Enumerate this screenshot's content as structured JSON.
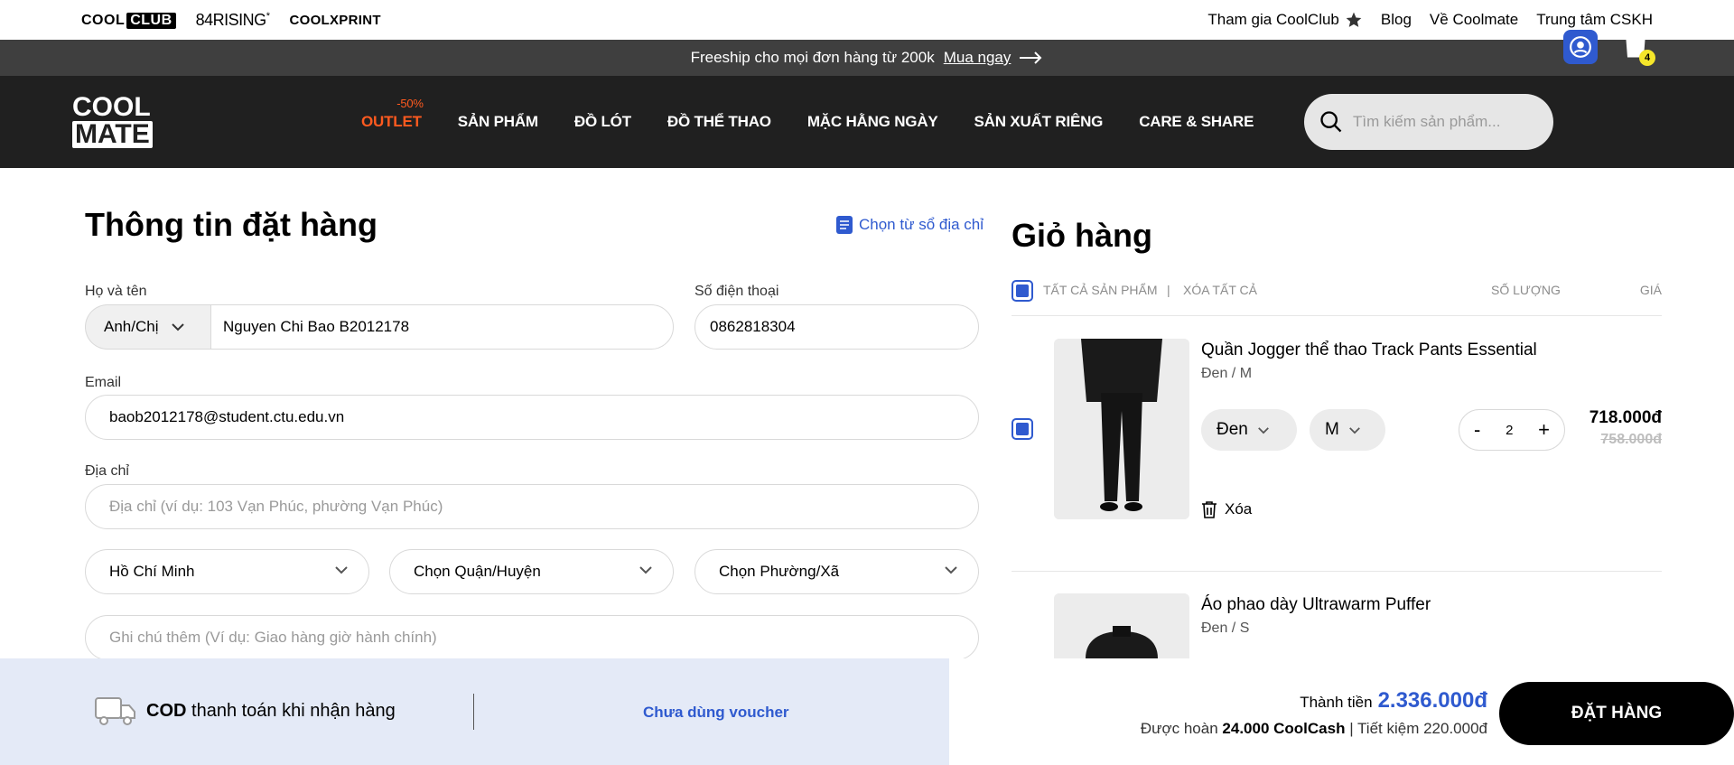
{
  "topbar": {
    "brands": {
      "coolclub_a": "COOL",
      "coolclub_b": "CLUB",
      "rising": "84RISING",
      "rising_sup": "*",
      "coolxprint": "COOLXPRINT"
    },
    "links": [
      "Tham gia CoolClub",
      "Blog",
      "Về Coolmate",
      "Trung tâm CSKH"
    ]
  },
  "promo": {
    "text": "Freeship cho mọi đơn hàng từ 200k",
    "cta": "Mua ngay"
  },
  "header": {
    "logo_top": "COOL",
    "logo_bottom": "MATE",
    "nav": {
      "outlet": "OUTLET",
      "outlet_badge": "-50%",
      "items": [
        "SẢN PHẨM",
        "ĐỒ LÓT",
        "ĐỒ THỂ THAO",
        "MẶC HẰNG NGÀY",
        "SẢN XUẤT RIÊNG",
        "CARE & SHARE"
      ]
    },
    "search_placeholder": "Tìm kiếm sản phẩm...",
    "cart_count": "4"
  },
  "form": {
    "title": "Thông tin đặt hàng",
    "address_book": "Chọn từ sổ địa chỉ",
    "name_label": "Họ và tên",
    "salutation": "Anh/Chị",
    "name_value": "Nguyen Chi Bao B2012178",
    "phone_label": "Số điện thoại",
    "phone_value": "0862818304",
    "email_label": "Email",
    "email_value": "baob2012178@student.ctu.edu.vn",
    "address_label": "Địa chỉ",
    "address_placeholder": "Địa chỉ (ví dụ: 103 Vạn Phúc, phường Vạn Phúc)",
    "city": "Hồ Chí Minh",
    "district": "Chọn Quận/Huyện",
    "ward": "Chọn Phường/Xã",
    "note_placeholder": "Ghi chú thêm (Ví dụ: Giao hàng giờ hành chính)"
  },
  "cart": {
    "title": "Giỏ hàng",
    "select_all": "TẤT CẢ SẢN PHẨM",
    "separator": "|",
    "delete_all": "XÓA TẤT CẢ",
    "qty_header": "SỐ LƯỢNG",
    "price_header": "GIÁ",
    "items": [
      {
        "name": "Quần Jogger thể thao Track Pants Essential",
        "variant": "Đen / M",
        "color": "Đen",
        "size": "M",
        "qty": "2",
        "minus": "-",
        "plus": "+",
        "price": "718.000đ",
        "old_price": "758.000đ",
        "remove": "Xóa"
      },
      {
        "name": "Áo phao dày Ultrawarm Puffer",
        "variant": "Đen / S"
      }
    ]
  },
  "footer": {
    "payment_bold": "COD",
    "payment_rest": "thanh toán khi nhận hàng",
    "voucher": "Chưa dùng voucher",
    "total_label": "Thành tiền",
    "total_value": "2.336.000đ",
    "cashback_prefix": "Được hoàn",
    "cashback_value": "24.000 CoolCash",
    "savings": "| Tiết kiệm 220.000đ",
    "order_button": "ĐẶT HÀNG"
  },
  "colors": {
    "accent": "#2f5acf",
    "outlet": "#ff5a1f",
    "header_bg": "#202020",
    "promo_bg": "#3f3f3f",
    "footer_left_bg": "#e4eaf7"
  }
}
